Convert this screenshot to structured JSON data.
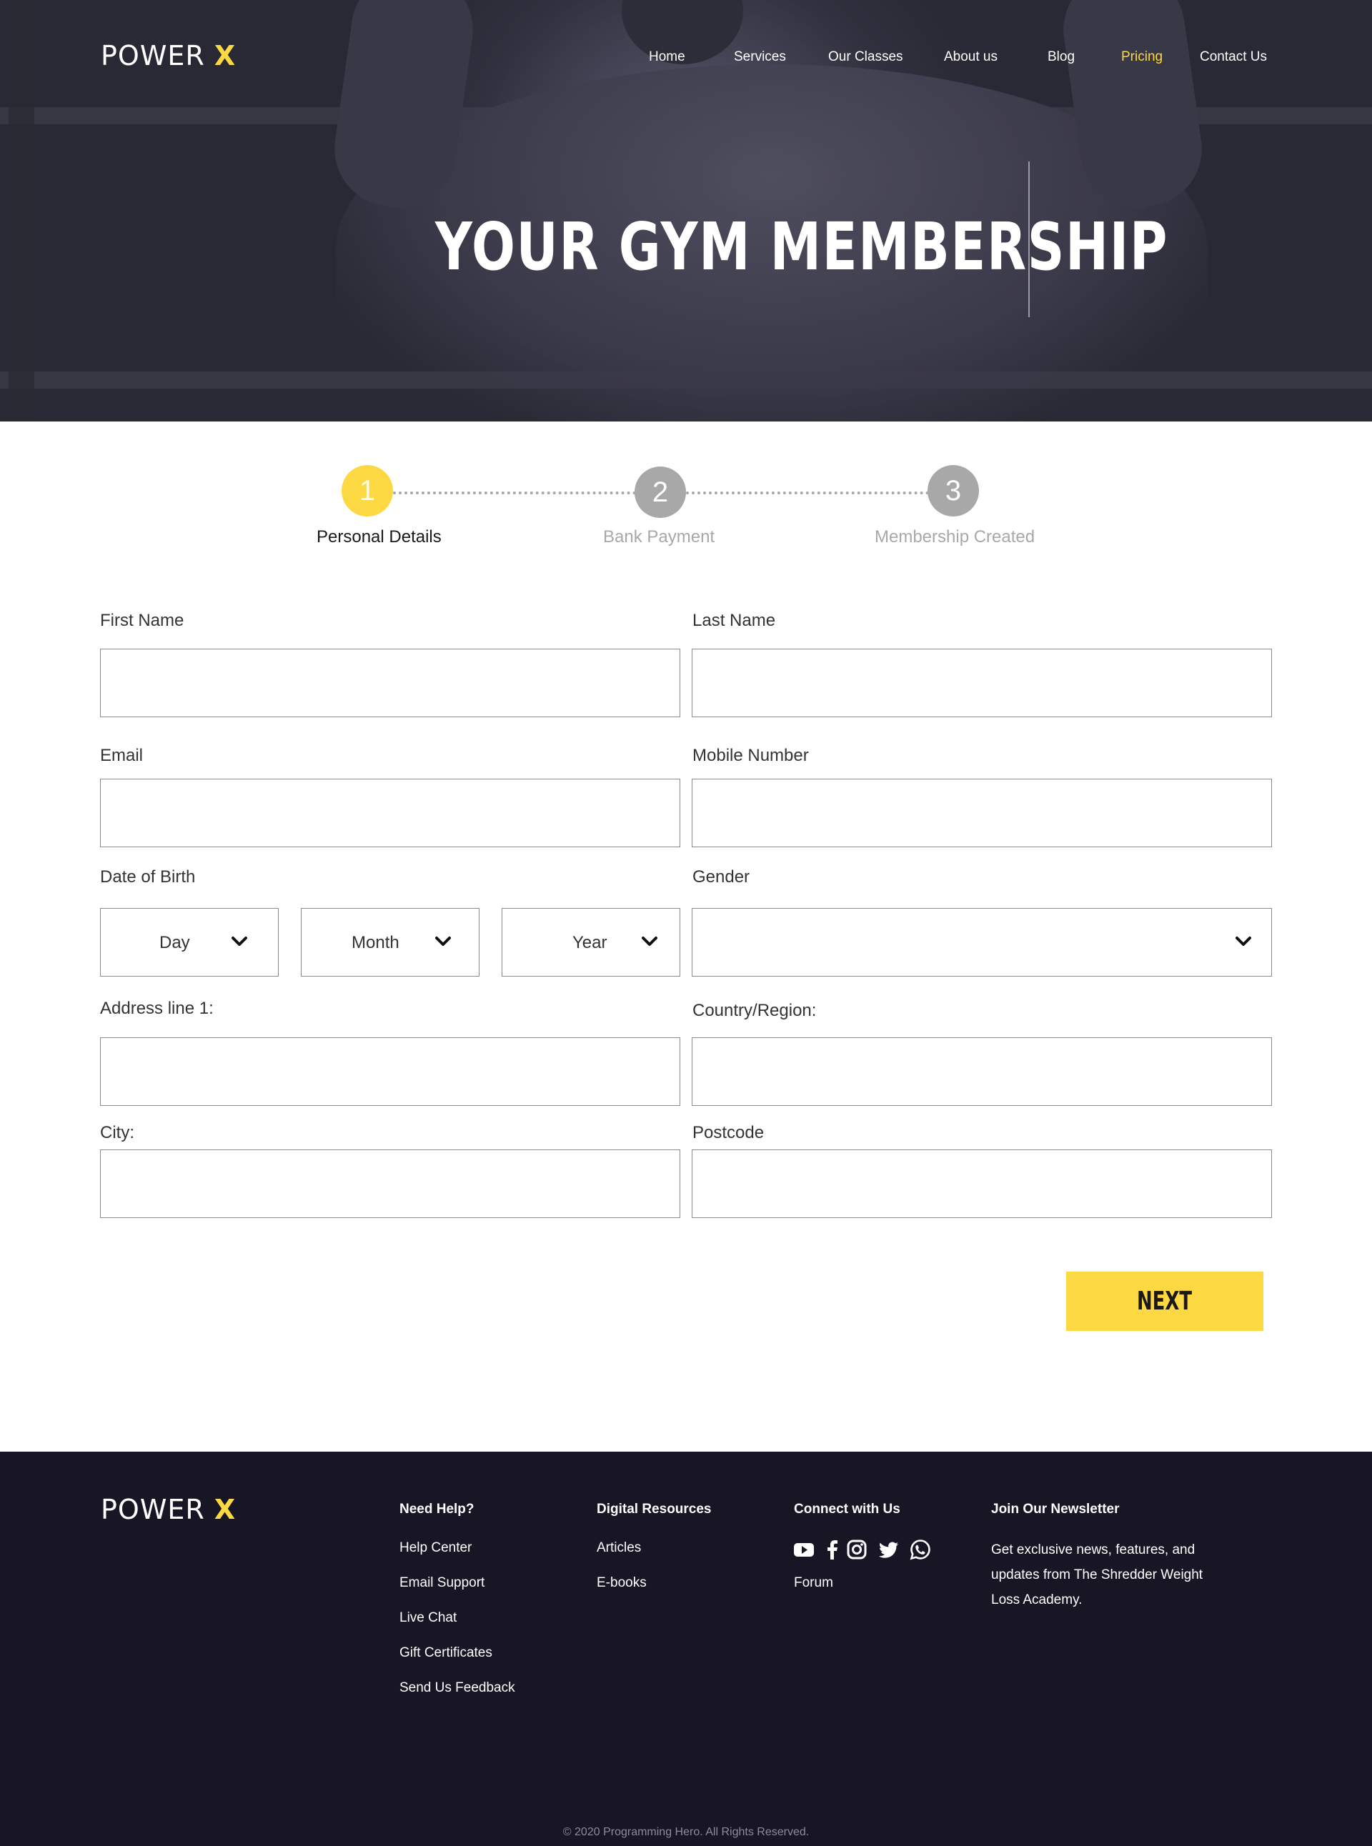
{
  "brand": {
    "name": "POWER",
    "mark": "X"
  },
  "nav": {
    "items": [
      "Home",
      "Services",
      "Our Classes",
      "About us",
      "Blog",
      "Pricing",
      "Contact Us"
    ],
    "active": "Pricing"
  },
  "hero": {
    "title": "YOUR GYM MEMBERSHIP"
  },
  "stepper": {
    "steps": [
      {
        "number": "1",
        "label": "Personal Details",
        "state": "active"
      },
      {
        "number": "2",
        "label": "Bank Payment",
        "state": "inactive"
      },
      {
        "number": "3",
        "label": "Membership Created",
        "state": "inactive"
      }
    ]
  },
  "form": {
    "first_name": {
      "label": "First Name",
      "value": ""
    },
    "last_name": {
      "label": "Last Name",
      "value": ""
    },
    "email": {
      "label": "Email",
      "value": ""
    },
    "mobile": {
      "label": "Mobile Number",
      "value": ""
    },
    "dob": {
      "label": "Date of Birth",
      "day": "Day",
      "month": "Month",
      "year": "Year"
    },
    "gender": {
      "label": "Gender",
      "value": ""
    },
    "address1": {
      "label": "Address line 1:",
      "value": ""
    },
    "country": {
      "label": "Country/Region:",
      "value": ""
    },
    "city": {
      "label": "City:",
      "value": ""
    },
    "postcode": {
      "label": "Postcode",
      "value": ""
    },
    "next_label": "NEXT"
  },
  "footer": {
    "need_help": {
      "heading": "Need Help?",
      "links": [
        "Help Center",
        "Email Support",
        "Live Chat",
        "Gift Certificates",
        "Send Us Feedback"
      ]
    },
    "digital": {
      "heading": "Digital Resources",
      "links": [
        "Articles",
        "E-books"
      ]
    },
    "connect": {
      "heading": "Connect with Us",
      "icons": [
        "youtube-icon",
        "facebook-icon",
        "instagram-icon",
        "twitter-icon",
        "whatsapp-icon"
      ],
      "forum": "Forum"
    },
    "newsletter": {
      "heading": "Join Our Newsletter",
      "text": "Get exclusive news, features, and updates from The Shredder Weight Loss Academy."
    },
    "copyright": "© 2020 Programming Hero. All Rights Reserved."
  },
  "colors": {
    "accent": "#fcd843",
    "inactive": "#a8a8a8",
    "footer_bg": "#181625"
  }
}
